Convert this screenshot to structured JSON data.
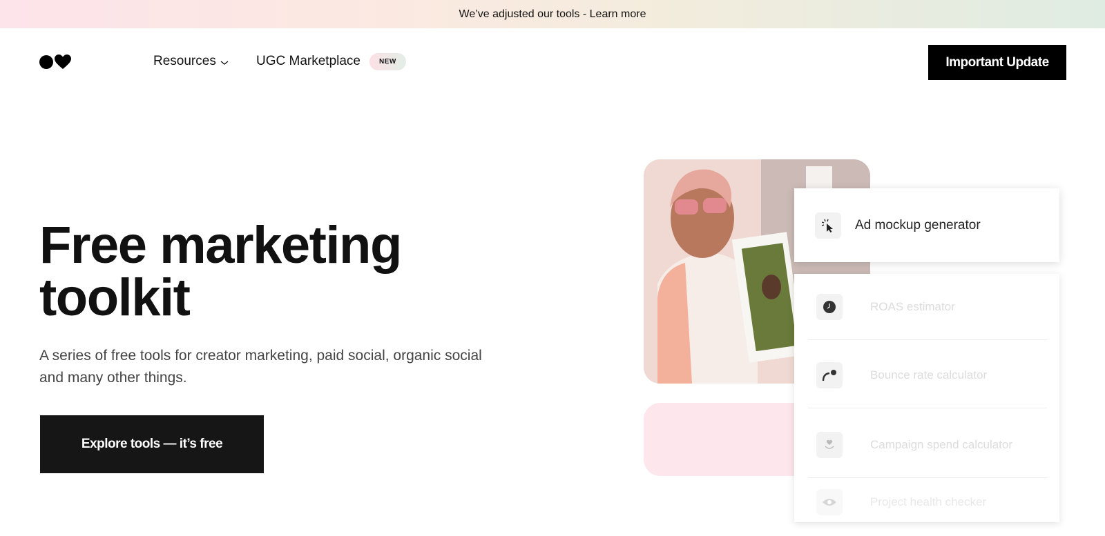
{
  "announcement": {
    "text": "We’ve adjusted our tools - Learn more"
  },
  "nav": {
    "resources_label": "Resources",
    "ugc_label": "UGC Marketplace",
    "new_badge": "NEW",
    "cta_label": "Important Update"
  },
  "hero": {
    "title": "Free marketing toolkit",
    "subtitle": "A series of free tools for creator marketing, paid social, organic social and many other things.",
    "cta_label": "Explore tools — it’s free"
  },
  "tools": {
    "active": {
      "label": "Ad mockup generator",
      "icon": "cursor-click-icon"
    },
    "list": [
      {
        "label": "ROAS estimator",
        "icon": "clock-icon"
      },
      {
        "label": "Bounce rate calculator",
        "icon": "arc-dot-icon"
      },
      {
        "label": "Campaign spend calculator",
        "icon": "heart-waves-icon"
      },
      {
        "label": "Project health checker",
        "icon": "eye-dollar-icon"
      }
    ]
  },
  "colors": {
    "primary": "#000000",
    "pink_panel": "#fde6ec",
    "faded_text": "#dcdcdc"
  }
}
